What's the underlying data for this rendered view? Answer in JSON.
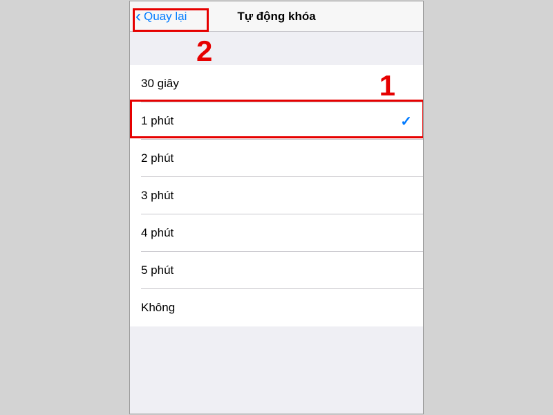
{
  "nav": {
    "back_label": "Quay lại",
    "title": "Tự động khóa"
  },
  "options": [
    {
      "label": "30 giây",
      "selected": false
    },
    {
      "label": "1 phút",
      "selected": true
    },
    {
      "label": "2 phút",
      "selected": false
    },
    {
      "label": "3 phút",
      "selected": false
    },
    {
      "label": "4 phút",
      "selected": false
    },
    {
      "label": "5 phút",
      "selected": false
    },
    {
      "label": "Không",
      "selected": false
    }
  ],
  "annotations": {
    "num1": "1",
    "num2": "2"
  }
}
